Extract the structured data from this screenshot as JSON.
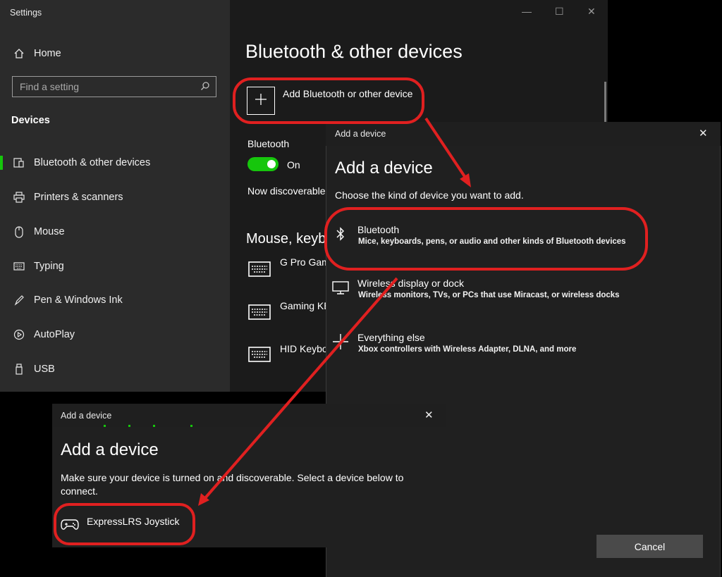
{
  "settings": {
    "window_title": "Settings",
    "nav": {
      "home": "Home",
      "search_placeholder": "Find a setting",
      "section": "Devices",
      "items": [
        {
          "label": "Bluetooth & other devices",
          "icon": "bluetooth-devices-icon"
        },
        {
          "label": "Printers & scanners",
          "icon": "printer-icon"
        },
        {
          "label": "Mouse",
          "icon": "mouse-icon"
        },
        {
          "label": "Typing",
          "icon": "keyboard-icon"
        },
        {
          "label": "Pen & Windows Ink",
          "icon": "pen-icon"
        },
        {
          "label": "AutoPlay",
          "icon": "autoplay-icon"
        },
        {
          "label": "USB",
          "icon": "usb-icon"
        }
      ]
    },
    "main": {
      "title": "Bluetooth & other devices",
      "add_device_label": "Add Bluetooth or other device",
      "bluetooth_label": "Bluetooth",
      "bluetooth_state": "On",
      "discoverable_text": "Now discoverable",
      "section_heading": "Mouse, keyb",
      "devices": [
        "G Pro Gam",
        "Gaming KE",
        "HID Keybo"
      ]
    }
  },
  "dialog_kind": {
    "titlebar": "Add a device",
    "title": "Add a device",
    "subtitle": "Choose the kind of device you want to add.",
    "options": [
      {
        "title": "Bluetooth",
        "description": "Mice, keyboards, pens, or audio and other kinds of Bluetooth devices",
        "icon": "bluetooth-icon"
      },
      {
        "title": "Wireless display or dock",
        "description": "Wireless monitors, TVs, or PCs that use Miracast, or wireless docks",
        "icon": "monitor-icon"
      },
      {
        "title": "Everything else",
        "description": "Xbox controllers with Wireless Adapter, DLNA, and more",
        "icon": "plus-icon"
      }
    ],
    "cancel_label": "Cancel"
  },
  "dialog_pair": {
    "titlebar": "Add a device",
    "title": "Add a device",
    "instructions": "Make sure your device is turned on and discoverable. Select a device below to connect.",
    "device_name": "ExpressLRS Joystick"
  },
  "colors": {
    "accent": "#16c60c",
    "annotation": "#e02020"
  }
}
